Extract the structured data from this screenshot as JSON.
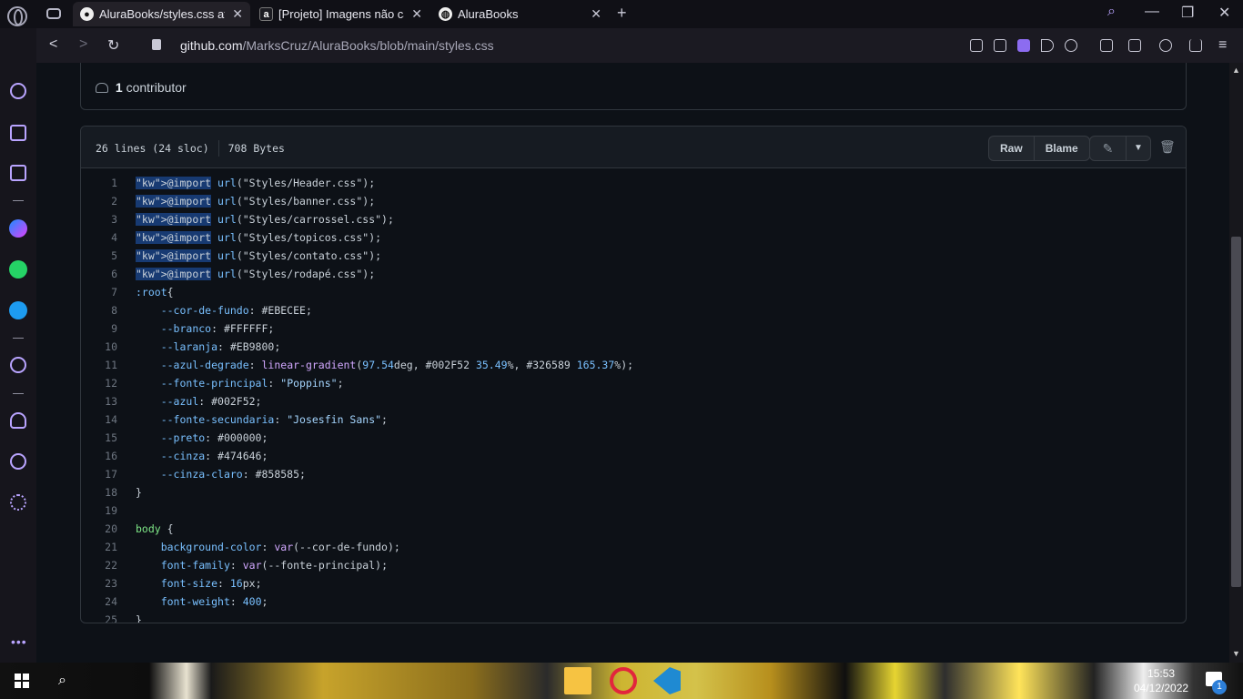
{
  "browser": {
    "tabs": [
      {
        "title": "AluraBooks/styles.css at main",
        "favicon": "github-icon",
        "active": true
      },
      {
        "title": "[Projeto] Imagens não carregam",
        "favicon": "alura-icon",
        "active": false
      },
      {
        "title": "AluraBooks",
        "favicon": "globe-icon",
        "active": false
      }
    ],
    "new_tab": "+",
    "controls": {
      "search": "⌕",
      "minimize": "—",
      "restore": "❐",
      "close": "✕"
    },
    "close_symbol": "✕",
    "url_domain": "github.com",
    "url_path": "/MarksCruz/AluraBooks/blob/main/styles.css"
  },
  "file": {
    "contributors_count": "1",
    "contributors_label": "contributor",
    "lines_info": "26 lines (24 sloc)",
    "size_info": "708 Bytes",
    "raw_label": "Raw",
    "blame_label": "Blame"
  },
  "code_lines": [
    "@import url(\"Styles/Header.css\");",
    "@import url(\"Styles/banner.css\");",
    "@import url(\"Styles/carrossel.css\");",
    "@import url(\"Styles/topicos.css\");",
    "@import url(\"Styles/contato.css\");",
    "@import url(\"Styles/rodapé.css\");",
    ":root{",
    "    --cor-de-fundo: #EBECEE;",
    "    --branco: #FFFFFF;",
    "    --laranja: #EB9800;",
    "    --azul-degrade: linear-gradient(97.54deg, #002F52 35.49%, #326589 165.37%);",
    "    --fonte-principal: \"Poppins\";",
    "    --azul: #002F52;",
    "    --fonte-secundaria: \"Josesfin Sans\";",
    "    --preto: #000000;",
    "    --cinza: #474646;",
    "    --cinza-claro: #858585;",
    "}",
    "",
    "body {",
    "    background-color: var(--cor-de-fundo);",
    "    font-family: var(--fonte-principal);",
    "    font-size: 16px;",
    "    font-weight: 400;",
    "}"
  ],
  "selected_lines": 6,
  "taskbar": {
    "time": "15:53",
    "date": "04/12/2022",
    "notifications": "1"
  }
}
